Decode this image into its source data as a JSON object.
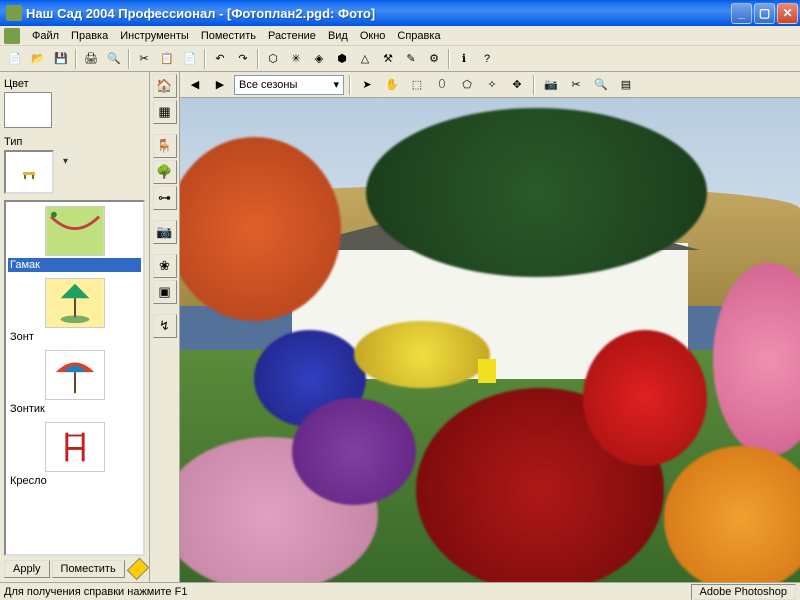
{
  "titlebar": {
    "text": "Наш Сад 2004 Профессионал - [Фотоплан2.pgd: Фото]"
  },
  "menu": {
    "file": "Файл",
    "edit": "Правка",
    "tools": "Инструменты",
    "place": "Поместить",
    "plant": "Растение",
    "view": "Вид",
    "window": "Окно",
    "help": "Справка"
  },
  "sidebar": {
    "color_label": "Цвет",
    "type_label": "Тип",
    "items": [
      {
        "label": "Гамак"
      },
      {
        "label": "Зонт"
      },
      {
        "label": "Зонтик"
      },
      {
        "label": "Кресло"
      }
    ],
    "apply_btn": "Apply",
    "place_btn": "Поместить"
  },
  "content_toolbar": {
    "season_selected": "Все сезоны"
  },
  "statusbar": {
    "help_hint": "Для получения справки нажмите F1",
    "app_tag": "Adobe Photoshop"
  },
  "colors": {
    "xp_blue": "#0054e3",
    "xp_close": "#c74a2b",
    "bg": "#ece9d8"
  }
}
